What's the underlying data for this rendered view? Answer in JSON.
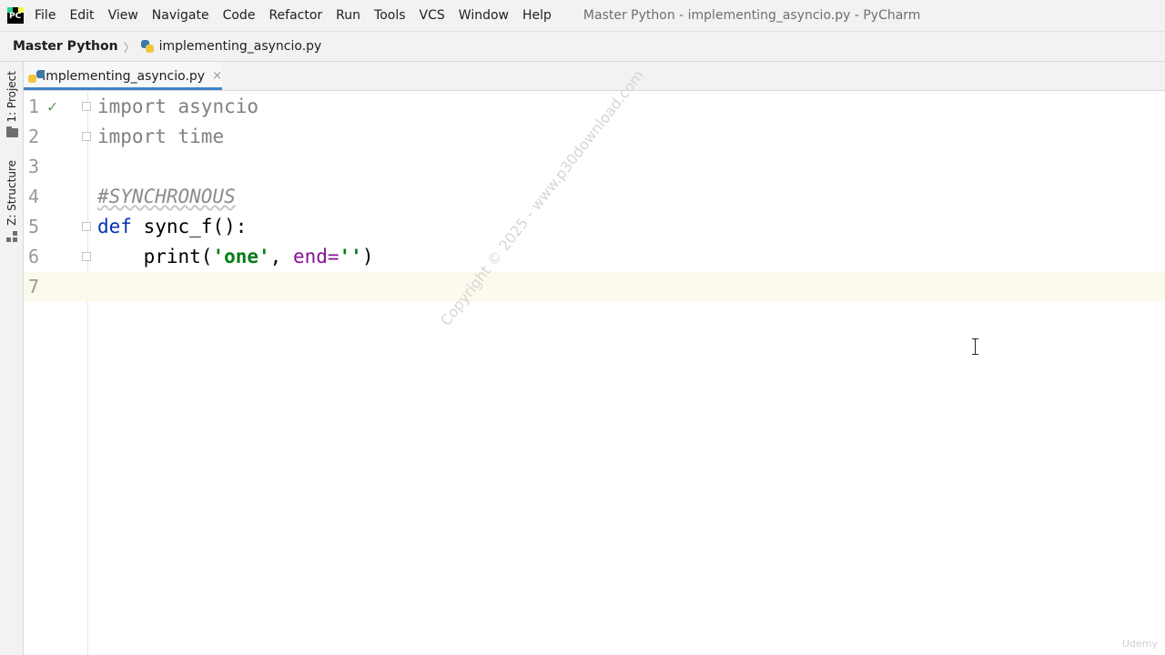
{
  "menu": {
    "logo_text": "PC",
    "items": [
      "File",
      "Edit",
      "View",
      "Navigate",
      "Code",
      "Refactor",
      "Run",
      "Tools",
      "VCS",
      "Window",
      "Help"
    ],
    "window_title": "Master Python - implementing_asyncio.py - PyCharm"
  },
  "breadcrumb": {
    "project": "Master Python",
    "file": "implementing_asyncio.py"
  },
  "sidebar": {
    "project_tab": "1: Project",
    "structure_tab": "Z: Structure"
  },
  "editor_tab": {
    "label": "implementing_asyncio.py",
    "close": "×"
  },
  "code": {
    "line_numbers": [
      "1",
      "2",
      "3",
      "4",
      "5",
      "6",
      "7"
    ],
    "l1_kw": "import",
    "l1_mod": "asyncio",
    "l2_kw": "import",
    "l2_mod": "time",
    "l4_comment": "#SYNCHRONOUS",
    "l5_kw": "def",
    "l5_rest": "sync_f():",
    "l6_fn": "print(",
    "l6_str": "'one'",
    "l6_sep": ", ",
    "l6_param": "end=",
    "l6_str2": "''",
    "l6_close": ")",
    "l1_status": "✓"
  },
  "watermark": "Copyright © 2025 - www.p30download.com",
  "udemy": "Udemy"
}
